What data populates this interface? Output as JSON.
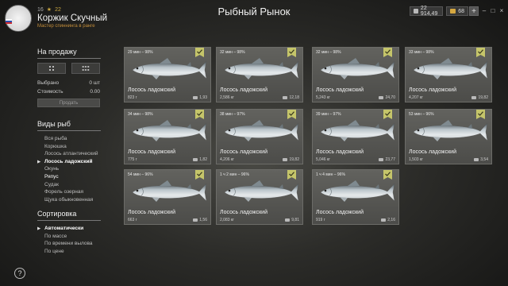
{
  "header": {
    "level": "16",
    "xp": "22",
    "player_name": "Коржик Скучный",
    "player_title": "Мастер спиннинга в ранге",
    "page_title": "Рыбный Рынок",
    "silver": "22 914,49",
    "gold": "68",
    "plus": "+",
    "controls": [
      "–",
      "□",
      "×"
    ]
  },
  "sale": {
    "heading": "На продажу",
    "selected_label": "Выбрано",
    "selected_value": "0 шт",
    "cost_label": "Стоимость",
    "cost_value": "0.00",
    "sell_button": "Продать"
  },
  "fish_types": {
    "heading": "Виды рыб",
    "items": [
      "Вся рыба",
      "Корюшка",
      "Лосось атлантический",
      "Лосось ладожский",
      "Окунь",
      "Ряпус",
      "Судак",
      "Форель озерная",
      "Щука обыкновенная"
    ],
    "active_index": 3
  },
  "sorting": {
    "heading": "Сортировка",
    "items": [
      "Автоматически",
      "По массе",
      "По времени вылова",
      "По цене"
    ],
    "active_index": 0
  },
  "help": "?",
  "cards": [
    {
      "tag": "29 мин – 98%",
      "name": "Лосось ладожский",
      "weight": "823 г",
      "price": "1,93"
    },
    {
      "tag": "32 мин – 98%",
      "name": "Лосось ладожский",
      "weight": "2,586 кг",
      "price": "12,18"
    },
    {
      "tag": "32 мин – 98%",
      "name": "Лосось ладожский",
      "weight": "5,243 кг",
      "price": "24,70"
    },
    {
      "tag": "33 мин – 98%",
      "name": "Лосось ладожский",
      "weight": "4,207 кг",
      "price": "19,82"
    },
    {
      "tag": "34 мин – 98%",
      "name": "Лосось ладожский",
      "weight": "775 г",
      "price": "1,82"
    },
    {
      "tag": "38 мин – 97%",
      "name": "Лосось ладожский",
      "weight": "4,206 кг",
      "price": "19,82"
    },
    {
      "tag": "39 мин – 97%",
      "name": "Лосось ладожский",
      "weight": "5,046 кг",
      "price": "23,77"
    },
    {
      "tag": "53 мин – 96%",
      "name": "Лосось ладожский",
      "weight": "1,503 кг",
      "price": "3,54"
    },
    {
      "tag": "54 мин – 96%",
      "name": "Лосось ладожский",
      "weight": "663 г",
      "price": "1,56"
    },
    {
      "tag": "1 ч 2 мин – 96%",
      "name": "Лосось ладожский",
      "weight": "2,083 кг",
      "price": "9,81"
    },
    {
      "tag": "1 ч 4 мин – 96%",
      "name": "Лосось ладожский",
      "weight": "919 г",
      "price": "2,16"
    }
  ],
  "colors": {
    "accent": "#c5c56a",
    "brand_orange": "#c38d3a"
  }
}
